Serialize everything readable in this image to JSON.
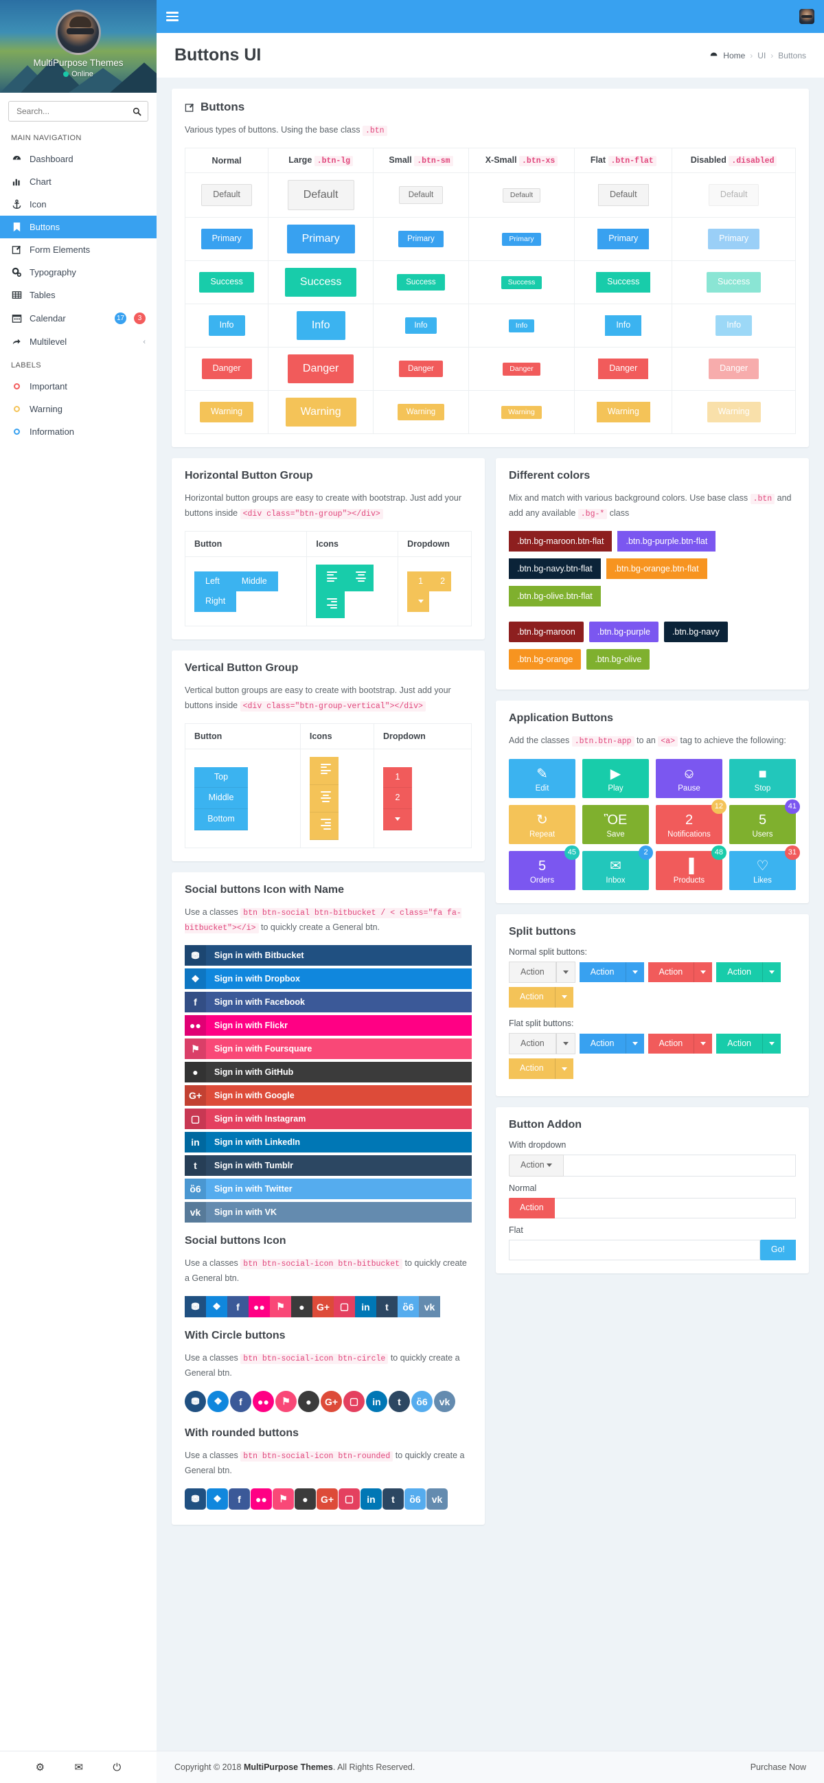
{
  "sidebar": {
    "profile": {
      "name": "MultiPurpose Themes",
      "status": "Online"
    },
    "search_placeholder": "Search...",
    "nav_heading": "MAIN NAVIGATION",
    "items": [
      {
        "label": "Dashboard",
        "icon": "dashboard-icon",
        "active": false
      },
      {
        "label": "Chart",
        "icon": "chart-icon",
        "active": false
      },
      {
        "label": "Icon",
        "icon": "anchor-icon",
        "active": false
      },
      {
        "label": "Buttons",
        "icon": "bookmark-icon",
        "active": true
      },
      {
        "label": "Form Elements",
        "icon": "edit-icon",
        "active": false
      },
      {
        "label": "Typography",
        "icon": "gears-icon",
        "active": false
      },
      {
        "label": "Tables",
        "icon": "table-icon",
        "active": false
      },
      {
        "label": "Calendar",
        "icon": "calendar-icon",
        "active": false,
        "badges": [
          {
            "text": "17",
            "color": "#38a1f0"
          },
          {
            "text": "3",
            "color": "#f35c5c"
          }
        ]
      },
      {
        "label": "Multilevel",
        "icon": "share-icon",
        "active": false,
        "chevron": "‹"
      }
    ],
    "labels_heading": "LABELS",
    "labels": [
      {
        "label": "Important",
        "color": "#f35c5c"
      },
      {
        "label": "Warning",
        "color": "#f4c358"
      },
      {
        "label": "Information",
        "color": "#38a1f0"
      }
    ]
  },
  "header": {
    "title": "Buttons UI",
    "breadcrumb": [
      "Home",
      "UI",
      "Buttons"
    ],
    "separator": "›"
  },
  "buttons_card": {
    "title": "Buttons",
    "desc_before": "Various types of buttons. Using the base class",
    "desc_code": ".btn",
    "columns": [
      {
        "name": "Normal",
        "code": ""
      },
      {
        "name": "Large",
        "code": ".btn-lg"
      },
      {
        "name": "Small",
        "code": ".btn-sm"
      },
      {
        "name": "X-Small",
        "code": ".btn-xs"
      },
      {
        "name": "Flat",
        "code": ".btn-flat"
      },
      {
        "name": "Disabled",
        "code": ".disabled"
      }
    ],
    "rows": [
      {
        "label": "Default",
        "kind": "default",
        "color": "#f4f4f4"
      },
      {
        "label": "Primary",
        "kind": "primary",
        "color": "#38a1f0"
      },
      {
        "label": "Success",
        "kind": "success",
        "color": "#18ccaa"
      },
      {
        "label": "Info",
        "kind": "info",
        "color": "#3bb3f0"
      },
      {
        "label": "Danger",
        "kind": "danger",
        "color": "#f15b5b"
      },
      {
        "label": "Warning",
        "kind": "warning",
        "color": "#f4c358"
      }
    ]
  },
  "horizontal_group": {
    "title": "Horizontal Button Group",
    "desc": "Horizontal button groups are easy to create with bootstrap. Just add your buttons inside",
    "desc_code": "<div class=\"btn-group\"></div>",
    "headers": [
      "Button",
      "Icons",
      "Dropdown"
    ],
    "buttons": [
      "Left",
      "Middle",
      "Right"
    ],
    "dropdown": [
      "1",
      "2"
    ]
  },
  "vertical_group": {
    "title": "Vertical Button Group",
    "desc": "Vertical button groups are easy to create with bootstrap. Just add your buttons inside",
    "desc_code": "<div class=\"btn-group-vertical\"></div>",
    "headers": [
      "Button",
      "Icons",
      "Dropdown"
    ],
    "buttons": [
      "Top",
      "Middle",
      "Bottom"
    ],
    "dropdown": [
      "1",
      "2"
    ]
  },
  "different_colors": {
    "title": "Different colors",
    "desc_a": "Mix and match with various background colors. Use base class",
    "code_btn": ".btn",
    "desc_b": "and add any available",
    "code_bg": ".bg-*",
    "desc_c": "class",
    "flat": [
      {
        "label": ".btn.bg-maroon.btn-flat",
        "color": "#8d1f1f"
      },
      {
        "label": ".btn.bg-purple.btn-flat",
        "color": "#7b57f0"
      },
      {
        "label": ".btn.bg-navy.btn-flat",
        "color": "#0b2338"
      },
      {
        "label": ".btn.bg-orange.btn-flat",
        "color": "#f79420"
      },
      {
        "label": ".btn.bg-olive.btn-flat",
        "color": "#7fb02e"
      }
    ],
    "solid": [
      {
        "label": ".btn.bg-maroon",
        "color": "#8d1f1f"
      },
      {
        "label": ".btn.bg-purple",
        "color": "#7b57f0"
      },
      {
        "label": ".btn.bg-navy",
        "color": "#0b2338"
      },
      {
        "label": ".btn.bg-orange",
        "color": "#f79420"
      },
      {
        "label": ".btn.bg-olive",
        "color": "#7fb02e"
      }
    ]
  },
  "application_buttons": {
    "title": "Application Buttons",
    "desc_a": "Add the classes",
    "code_a": ".btn.btn-app",
    "desc_b": "to an",
    "code_b": "<a>",
    "desc_c": "tag to achieve the following:",
    "items": [
      {
        "label": "Edit",
        "icon": "edit-icon",
        "glyph": "✎",
        "color": "#3bb3f0"
      },
      {
        "label": "Play",
        "icon": "play-icon",
        "glyph": "▶",
        "color": "#18ccaa"
      },
      {
        "label": "Pause",
        "icon": "pause-icon",
        "glyph": "⎉",
        "color": "#7b57f0"
      },
      {
        "label": "Stop",
        "icon": "stop-icon",
        "glyph": "■",
        "color": "#22c7bb"
      },
      {
        "label": "Repeat",
        "icon": "repeat-icon",
        "glyph": "↻",
        "color": "#f4c358"
      },
      {
        "label": "Save",
        "icon": "save-icon",
        "glyph": "ὋE",
        "color": "#7fb02e"
      },
      {
        "label": "Notifications",
        "icon": "megaphone-icon",
        "glyph": "὎2",
        "color": "#f15b5b",
        "badge": "12",
        "badge_color": "#f4c358"
      },
      {
        "label": "Users",
        "icon": "users-icon",
        "glyph": "὆5",
        "color": "#7fb02e",
        "badge": "41",
        "badge_color": "#7b57f0"
      },
      {
        "label": "Orders",
        "icon": "inbox-icon",
        "glyph": "὎5",
        "color": "#7b57f0",
        "badge": "45",
        "badge_color": "#22c7bb"
      },
      {
        "label": "Inbox",
        "icon": "envelope-icon",
        "glyph": "✉",
        "color": "#22c7bb",
        "badge": "2",
        "badge_color": "#38a1f0"
      },
      {
        "label": "Products",
        "icon": "barcode-icon",
        "glyph": "▐",
        "color": "#f15b5b",
        "badge": "48",
        "badge_color": "#18ccaa"
      },
      {
        "label": "Likes",
        "icon": "heart-icon",
        "glyph": "♡",
        "color": "#3bb3f0",
        "badge": "31",
        "badge_color": "#f15b5b"
      }
    ]
  },
  "split_buttons": {
    "title": "Split buttons",
    "normal_label": "Normal split buttons:",
    "flat_label": "Flat split buttons:",
    "action_label": "Action",
    "variants": [
      {
        "kind": "default",
        "color": "#f4f4f4"
      },
      {
        "kind": "primary",
        "color": "#38a1f0"
      },
      {
        "kind": "danger",
        "color": "#f15b5b"
      },
      {
        "kind": "success",
        "color": "#18ccaa"
      },
      {
        "kind": "warning",
        "color": "#f4c358"
      }
    ]
  },
  "button_addon": {
    "title": "Button Addon",
    "dropdown_label": "With dropdown",
    "dropdown_action": "Action",
    "normal_label": "Normal",
    "normal_action": "Action",
    "flat_label": "Flat",
    "go_label": "Go!",
    "input_value": "",
    "input_placeholder": ""
  },
  "social_named": {
    "title": "Social buttons Icon with Name",
    "desc_a": "Use a classes",
    "code_a": "btn btn-social btn-bitbucket / < class=\"fa fa-bitbucket\"></i>",
    "desc_b": "to quickly create a General btn.",
    "items": [
      {
        "label": "Sign in with Bitbucket",
        "icon": "bitbucket-icon",
        "glyph": "⛃",
        "color": "#205081"
      },
      {
        "label": "Sign in with Dropbox",
        "icon": "dropbox-icon",
        "glyph": "❖",
        "color": "#1087dd"
      },
      {
        "label": "Sign in with Facebook",
        "icon": "facebook-icon",
        "glyph": "f",
        "color": "#3b5998"
      },
      {
        "label": "Sign in with Flickr",
        "icon": "flickr-icon",
        "glyph": "●●",
        "color": "#ff0084"
      },
      {
        "label": "Sign in with Foursquare",
        "icon": "foursquare-icon",
        "glyph": "⚑",
        "color": "#f94877"
      },
      {
        "label": "Sign in with GitHub",
        "icon": "github-icon",
        "glyph": "●",
        "color": "#3b3b3b"
      },
      {
        "label": "Sign in with Google",
        "icon": "google-plus-icon",
        "glyph": "G+",
        "color": "#dd4b39"
      },
      {
        "label": "Sign in with Instagram",
        "icon": "instagram-icon",
        "glyph": "▢",
        "color": "#e4405f"
      },
      {
        "label": "Sign in with LinkedIn",
        "icon": "linkedin-icon",
        "glyph": "in",
        "color": "#0077b5"
      },
      {
        "label": "Sign in with Tumblr",
        "icon": "tumblr-icon",
        "glyph": "t",
        "color": "#2c4762"
      },
      {
        "label": "Sign in with Twitter",
        "icon": "twitter-icon",
        "glyph": "ὂ6",
        "color": "#55acee"
      },
      {
        "label": "Sign in with VK",
        "icon": "vk-icon",
        "glyph": "vk",
        "color": "#648baf"
      }
    ]
  },
  "social_icon": {
    "title": "Social buttons Icon",
    "desc_a": "Use a classes",
    "code_a": "btn btn-social-icon btn-bitbucket",
    "desc_b": "to quickly create a General btn."
  },
  "social_circle": {
    "title": "With Circle buttons",
    "desc_a": "Use a classes",
    "code_a": "btn btn-social-icon btn-circle",
    "desc_b": "to quickly create a General btn."
  },
  "social_rounded": {
    "title": "With rounded buttons",
    "desc_a": "Use a classes",
    "code_a": "btn btn-social-icon btn-rounded",
    "desc_b": "to quickly create a General btn."
  },
  "footer": {
    "copyright_prefix": "Copyright © 2018 ",
    "brand": "MultiPurpose Themes",
    "copyright_suffix": ". All Rights Reserved.",
    "purchase": "Purchase Now"
  }
}
